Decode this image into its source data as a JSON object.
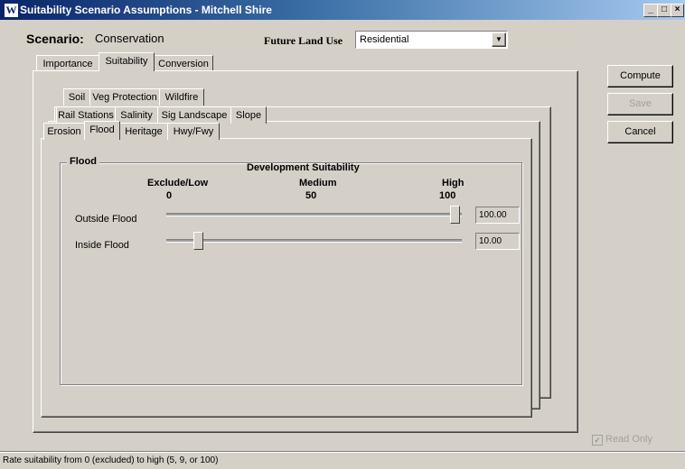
{
  "window": {
    "title": "Suitability Scenario Assumptions - Mitchell Shire",
    "app_icon": "W"
  },
  "header": {
    "scenario_label": "Scenario:",
    "scenario_value": "Conservation",
    "future_land_use_label": "Future Land Use",
    "future_land_use_value": "Residential"
  },
  "main_tabs": [
    "Importance",
    "Suitability",
    "Conversion"
  ],
  "sub_tabs_row1": [
    "Soil",
    "Veg Protection",
    "Wildfire"
  ],
  "sub_tabs_row2": [
    "Rail Stations",
    "Salinity",
    "Sig Landscape",
    "Slope"
  ],
  "sub_tabs_row3": [
    "Erosion",
    "Flood",
    "Heritage",
    "Hwy/Fwy"
  ],
  "flood": {
    "group_title": "Flood",
    "heading": "Development Suitability",
    "low_label": "Exclude/Low",
    "low_value": "0",
    "mid_label": "Medium",
    "mid_value": "50",
    "high_label": "High",
    "high_value": "100",
    "rows": [
      {
        "label": "Outside Flood",
        "value": "100.00",
        "level": 100
      },
      {
        "label": "Inside Flood",
        "value": "10.00",
        "level": 10
      }
    ]
  },
  "buttons": {
    "compute": "Compute",
    "save": "Save",
    "cancel": "Cancel"
  },
  "read_only_label": "Read Only",
  "status_text": "Rate suitability from 0 (excluded) to high (5, 9, or 100)"
}
